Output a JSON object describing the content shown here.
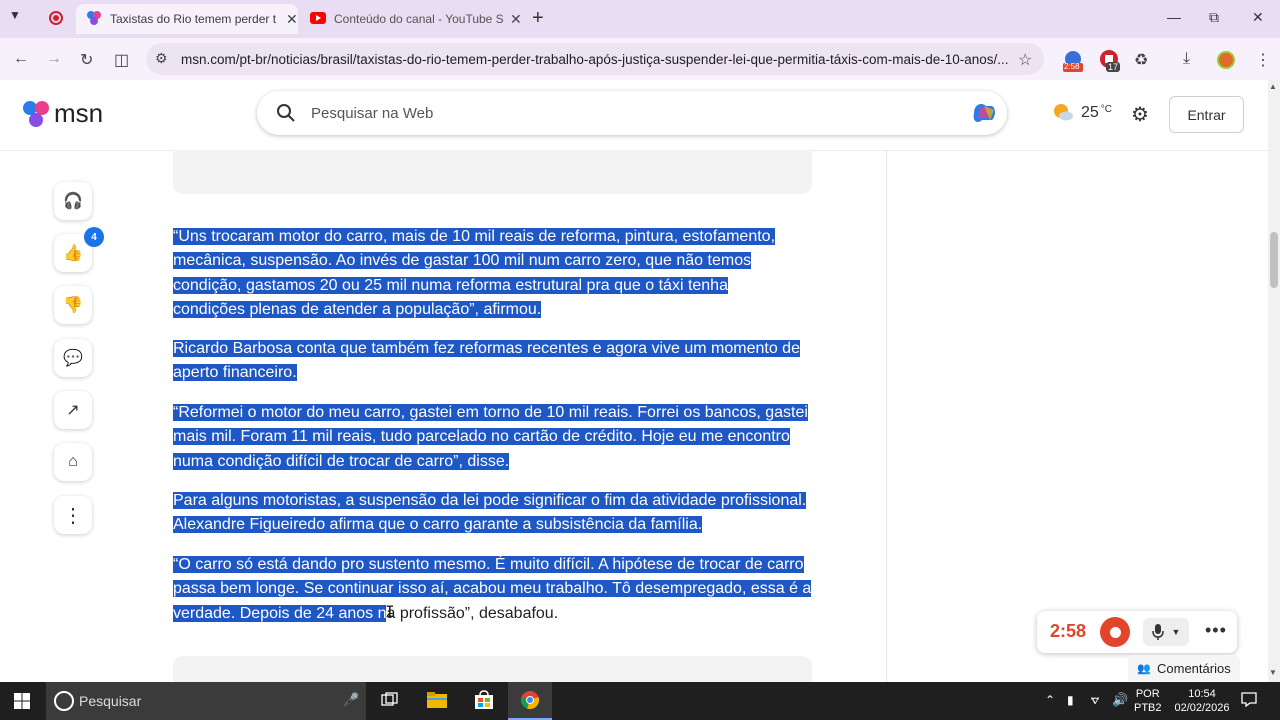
{
  "browser": {
    "tabs": [
      {
        "title": "Taxistas do Rio temem perder t",
        "active": true
      },
      {
        "title": "Conteúdo do canal - YouTube S",
        "active": false
      }
    ],
    "url": "msn.com/pt-br/noticias/brasil/taxistas-do-rio-temem-perder-trabalho-após-justiça-suspender-lei-que-permitia-táxis-com-mais-de-10-anos/...",
    "extension_badge_1": "2:58",
    "extension_badge_2": "17"
  },
  "msn": {
    "logo_text": "msn",
    "search_placeholder": "Pesquisar na Web",
    "temperature": "25",
    "temperature_unit": "°C",
    "signin_label": "Entrar"
  },
  "rail": {
    "like_count": "4"
  },
  "article": {
    "paragraphs": [
      {
        "lines": [
          "“Uns trocaram motor do carro, mais de 10 mil reais de reforma, pintura, estofamento,",
          "mecânica, suspensão. Ao invés de gastar 100 mil num carro zero, que não temos",
          "condição, gastamos 20 ou 25 mil numa reforma estrutural pra que o táxi tenha",
          "condições plenas de atender a população”, afirmou."
        ]
      },
      {
        "lines": [
          "Ricardo Barbosa conta que também fez reformas recentes e agora vive um momento de",
          "aperto financeiro."
        ]
      },
      {
        "lines": [
          "“Reformei o motor do meu carro, gastei em torno de 10 mil reais. Forrei os bancos, gastei",
          "mais mil. Foram 11 mil reais, tudo parcelado no cartão de crédito. Hoje eu me encontro",
          "numa condição difícil de trocar de carro”, disse."
        ]
      },
      {
        "lines": [
          "Para alguns motoristas, a suspensão da lei pode significar o fim da atividade profissional.",
          "Alexandre Figueiredo afirma que o carro garante a subsistência da família."
        ]
      },
      {
        "lines": [
          "“O carro só está dando pro sustento mesmo. É muito difícil. A hipótese de trocar de carro",
          "passa bem longe. Se continuar isso aí, acabou meu trabalho. Tô desempregado, essa é a"
        ],
        "last_selected": "verdade. Depois de 24 anos n",
        "last_rest": "a profissão”, desabafou."
      }
    ]
  },
  "recorder": {
    "time": "2:58"
  },
  "comments_label": "Comentários",
  "taskbar": {
    "search_placeholder": "Pesquisar",
    "lang_1": "POR",
    "lang_2": "PTB2",
    "time": "10:54",
    "date": "02/02/2026"
  },
  "colors": {
    "selection": "#1e57c6",
    "tabstrip": "#e8ddf3",
    "recorder_red": "#e2452b"
  }
}
